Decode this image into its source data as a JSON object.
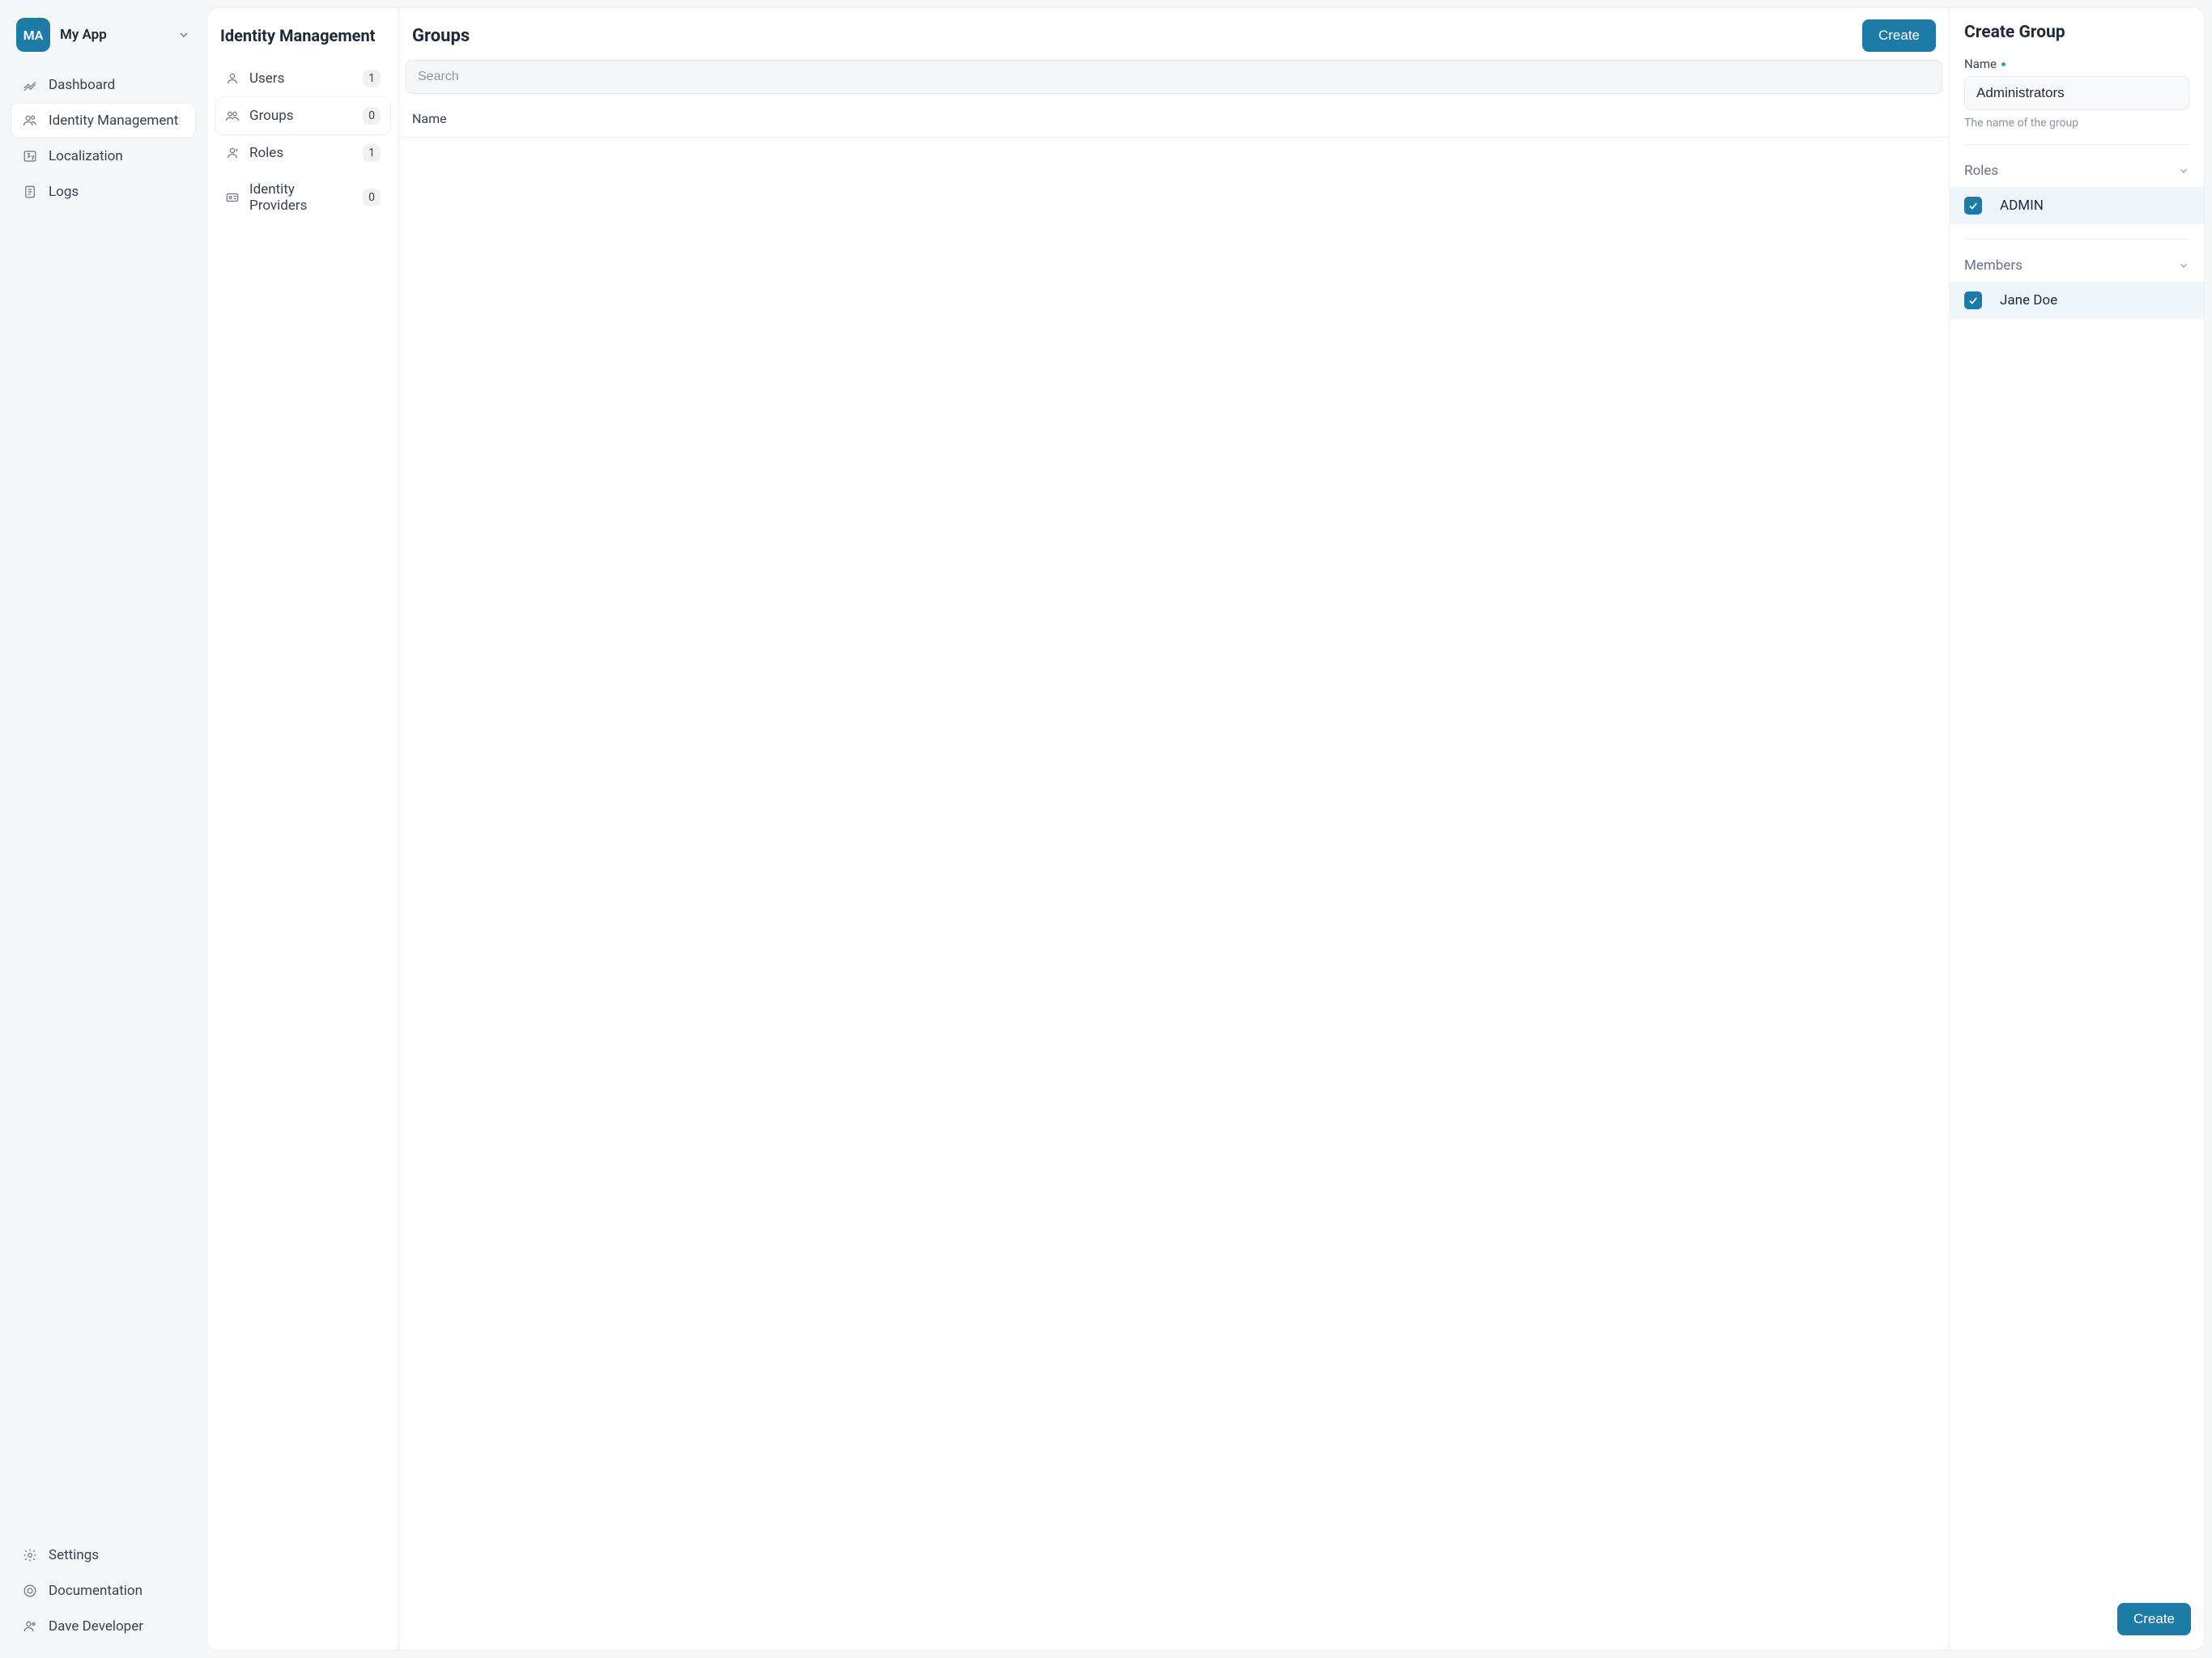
{
  "app": {
    "logo_text": "MA",
    "name": "My App"
  },
  "sidebar": {
    "items": [
      {
        "label": "Dashboard"
      },
      {
        "label": "Identity Management"
      },
      {
        "label": "Localization"
      },
      {
        "label": "Logs"
      }
    ],
    "footer": [
      {
        "label": "Settings"
      },
      {
        "label": "Documentation"
      },
      {
        "label": "Dave Developer"
      }
    ]
  },
  "subnav": {
    "title": "Identity Management",
    "items": [
      {
        "label": "Users",
        "count": "1"
      },
      {
        "label": "Groups",
        "count": "0"
      },
      {
        "label": "Roles",
        "count": "1"
      },
      {
        "label": "Identity Providers",
        "count": "0"
      }
    ]
  },
  "list": {
    "title": "Groups",
    "create_label": "Create",
    "search_placeholder": "Search",
    "column_name": "Name"
  },
  "form": {
    "title": "Create Group",
    "name_label": "Name",
    "name_value": "Administrators",
    "name_help": "The name of the group",
    "roles_label": "Roles",
    "roles": [
      {
        "name": "ADMIN",
        "checked": true
      }
    ],
    "members_label": "Members",
    "members": [
      {
        "name": "Jane Doe",
        "checked": true
      }
    ],
    "submit_label": "Create"
  }
}
